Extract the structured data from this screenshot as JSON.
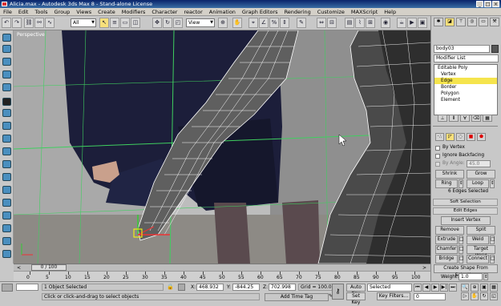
{
  "window": {
    "title": "Alicia.max - Autodesk 3ds Max 8 - Stand-alone License"
  },
  "menu": [
    "File",
    "Edit",
    "Tools",
    "Group",
    "Views",
    "Create",
    "Modifiers",
    "Character",
    "reactor",
    "Animation",
    "Graph Editors",
    "Rendering",
    "Customize",
    "MAXScript",
    "Help"
  ],
  "toolbar": {
    "selection_filter": "All",
    "ref_coord": "View"
  },
  "viewport": {
    "label": "Perspective"
  },
  "panel": {
    "object_name": "body03",
    "modifier_list": "Modifier List",
    "stack": [
      "Editable Poly",
      "Vertex",
      "Edge",
      "Border",
      "Polygon",
      "Element"
    ],
    "stack_selected_index": 2,
    "selection": {
      "by_vertex": "By Vertex",
      "ignore_backfacing": "Ignore Backfacing",
      "by_angle": "By Angle:",
      "by_angle_value": "45.0",
      "shrink": "Shrink",
      "grow": "Grow",
      "ring": "Ring",
      "loop": "Loop",
      "status": "6 Edges Selected"
    },
    "soft_selection": "Soft Selection",
    "edit_edges": {
      "header": "Edit Edges",
      "insert_vertex": "Insert Vertex",
      "remove": "Remove",
      "split": "Split",
      "extrude": "Extrude",
      "weld": "Weld",
      "chamfer": "Chamfer",
      "target_weld": "Target Weld",
      "bridge": "Bridge",
      "connect": "Connect",
      "create_shape": "Create Shape From Selection",
      "weight_label": "Weight:",
      "weight_value": "1.0"
    }
  },
  "timeline": {
    "frame": "0 / 100",
    "ticks": [
      "0",
      "5",
      "10",
      "15",
      "20",
      "25",
      "30",
      "35",
      "40",
      "45",
      "50",
      "55",
      "60",
      "65",
      "70",
      "75",
      "80",
      "85",
      "90",
      "95",
      "100"
    ]
  },
  "status": {
    "objects": "1 Object Selected",
    "prompt": "Click or click-and-drag to select objects",
    "x_label": "X:",
    "x": "468.932",
    "y_label": "Y:",
    "y": "-844.25",
    "z_label": "Z:",
    "z": "702.998",
    "grid": "Grid = 100.0",
    "add_time_tag": "Add Time Tag",
    "auto_key": "Auto Key",
    "set_key": "Set Key",
    "selected": "Selected",
    "key_filters": "Key Filters...",
    "frame_value": "0"
  },
  "colors": {
    "accent": "#f5e44d",
    "title_bar": "#0a246a",
    "wire": "#ffffff",
    "grid": "#3fcf5f"
  }
}
